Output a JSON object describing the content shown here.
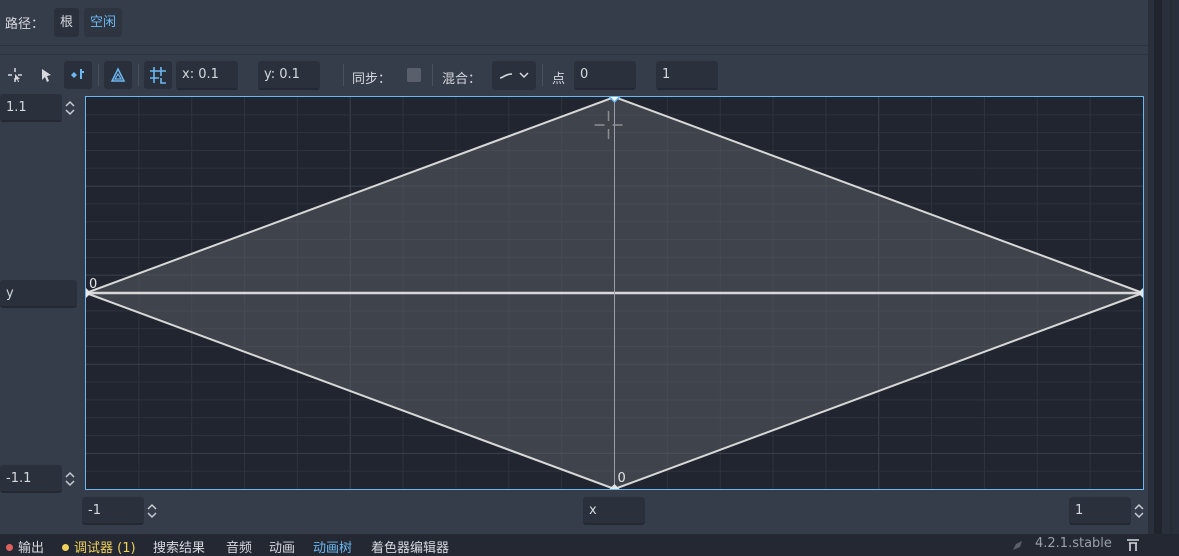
{
  "path_bar": {
    "label": "路径：",
    "crumbs": [
      "根",
      "空闲"
    ]
  },
  "toolbar": {
    "icons": [
      "select-points-icon",
      "create-points-icon",
      "erase-points-icon",
      "create-triangles-icon",
      "snap-grid-icon"
    ],
    "snap_x": "x: 0.1",
    "snap_y": "y: 0.1",
    "sync_label": "同步：",
    "sync_checked": false,
    "blend_label": "混合：",
    "point_label": "点",
    "point_index": "0",
    "point_value": "1"
  },
  "axes": {
    "max_y": "1.1",
    "y_label": "y",
    "min_y": "-1.1",
    "min_x": "-1",
    "x_label": "x",
    "max_x": "1"
  },
  "blend_space": {
    "x_range": [
      -1,
      1
    ],
    "y_range": [
      -1.1,
      1.1
    ],
    "points": [
      {
        "x": -1,
        "y": 0
      },
      {
        "x": 0,
        "y": 1.1
      },
      {
        "x": 1,
        "y": 0
      },
      {
        "x": 0,
        "y": -1.1
      }
    ],
    "point_labels": [
      "0",
      "0"
    ],
    "selected_point": {
      "x": 0,
      "y": 1.1
    },
    "colors": {
      "accent": "#6ab7f2",
      "edge": "#d8d8d8",
      "fill": "#5a5d63"
    }
  },
  "bottom_tabs": [
    {
      "label": "输出",
      "dot": "#e0605e"
    },
    {
      "label": "调试器 (1)",
      "dot": "#f1d15a"
    },
    {
      "label": "搜索结果"
    },
    {
      "label": "音频"
    },
    {
      "label": "动画"
    },
    {
      "label": "动画树"
    },
    {
      "label": "着色器编辑器"
    }
  ],
  "version": "4.2.1.stable"
}
